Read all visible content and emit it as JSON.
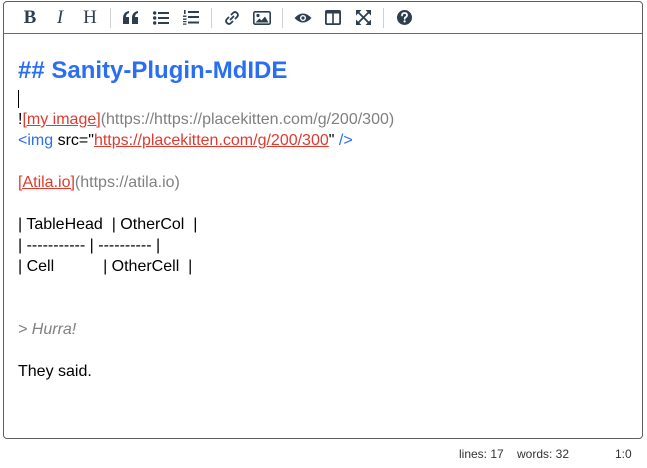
{
  "toolbar": {
    "bold": "B",
    "italic": "I",
    "heading": "H"
  },
  "content": {
    "heading": "## Sanity-Plugin-MdIDE",
    "img_md": {
      "bang": "!",
      "link_text": "[my image]",
      "url": "(https://https://placekitten.com/g/200/300)"
    },
    "img_html": {
      "open": "<img",
      "attr_name": " src=",
      "quote_open": "\"",
      "url": "https://placekitten.com/g/200/300",
      "quote_close": "\"",
      "close": " />"
    },
    "atila_link": {
      "link_text": "[Atila.io]",
      "url": "(https://atila.io)"
    },
    "table": [
      "| TableHead  | OtherCol  |",
      "| ----------- | ---------- |",
      "| Cell           | OtherCell  |"
    ],
    "quote": "> Hurra!",
    "paragraph": "They said."
  },
  "status": {
    "lines": "lines: 17",
    "words": "words: 32",
    "cursor": "1:0"
  }
}
